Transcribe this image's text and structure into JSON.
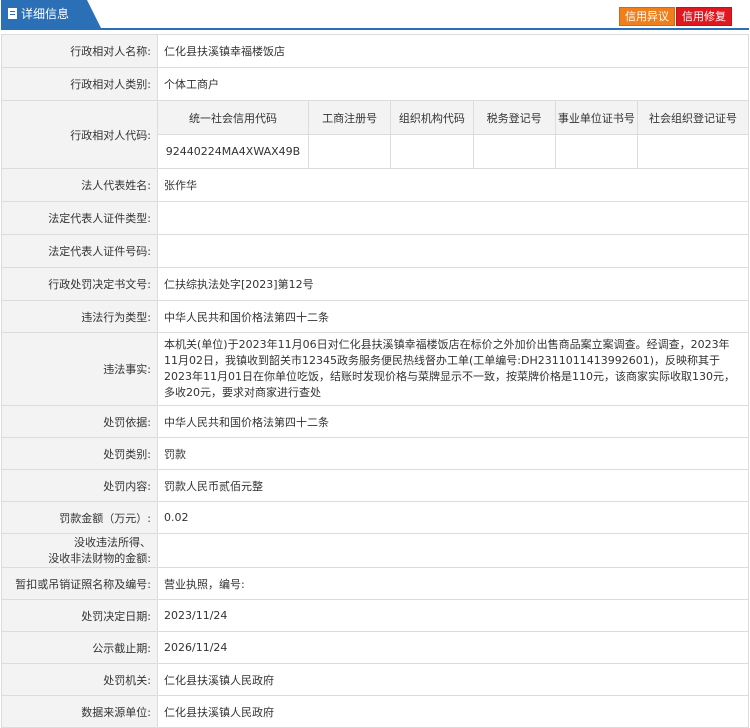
{
  "header": {
    "tab_label": "详细信息",
    "button_objection": "信用异议",
    "button_repair": "信用修复"
  },
  "rows_top": [
    {
      "label": "行政相对人名称:",
      "value": "仁化县扶溪镇幸福楼饭店"
    },
    {
      "label": "行政相对人类别:",
      "value": "个体工商户"
    }
  ],
  "codes": {
    "label": "行政相对人代码:",
    "headers": [
      "统一社会信用代码",
      "工商注册号",
      "组织机构代码",
      "税务登记号",
      "事业单位证书号",
      "社会组织登记证号"
    ],
    "values": [
      "92440224MA4XWAX49B",
      "",
      "",
      "",
      "",
      ""
    ]
  },
  "rows_mid": [
    {
      "label": "法人代表姓名:",
      "value": "张作华"
    },
    {
      "label": "法定代表人证件类型:",
      "value": ""
    },
    {
      "label": "法定代表人证件号码:",
      "value": ""
    },
    {
      "label": "行政处罚决定书文号:",
      "value": "仁扶综执法处字[2023]第12号"
    },
    {
      "label": "违法行为类型:",
      "value": "中华人民共和国价格法第四十二条"
    }
  ],
  "facts": {
    "label": "违法事实:",
    "value": "本机关(单位)于2023年11月06日对仁化县扶溪镇幸福楼饭店在标价之外加价出售商品案立案调查。经调查，2023年11月02日，我镇收到韶关市12345政务服务便民热线督办工单(工单编号:DH2311011413992601)，反映称其于2023年11月01日在你单位吃饭，结账时发现价格与菜牌显示不一致，按菜牌价格是110元，该商家实际收取130元，多收20元，要求对商家进行查处"
  },
  "rows_bottom": [
    {
      "label": "处罚依据:",
      "value": "中华人民共和国价格法第四十二条"
    },
    {
      "label": "处罚类别:",
      "value": "罚款"
    },
    {
      "label": "处罚内容:",
      "value": "罚款人民币贰佰元整"
    },
    {
      "label": "罚款金额（万元）:",
      "value": "0.02"
    }
  ],
  "confiscation": {
    "label_line1": "没收违法所得、",
    "label_line2": "没收非法财物的金额:",
    "value": ""
  },
  "rows_end": [
    {
      "label": "暂扣或吊销证照名称及编号:",
      "value": "营业执照，编号:"
    },
    {
      "label": "处罚决定日期:",
      "value": "2023/11/24"
    },
    {
      "label": "公示截止期:",
      "value": "2026/11/24"
    },
    {
      "label": "处罚机关:",
      "value": "仁化县扶溪镇人民政府"
    },
    {
      "label": "数据来源单位:",
      "value": "仁化县扶溪镇人民政府"
    }
  ]
}
